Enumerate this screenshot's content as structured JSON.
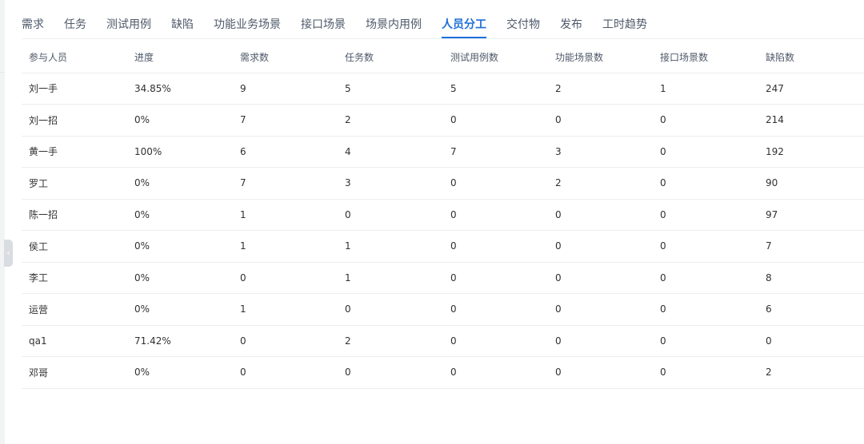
{
  "tabs": [
    {
      "label": "需求",
      "active": false
    },
    {
      "label": "任务",
      "active": false
    },
    {
      "label": "测试用例",
      "active": false
    },
    {
      "label": "缺陷",
      "active": false
    },
    {
      "label": "功能业务场景",
      "active": false
    },
    {
      "label": "接口场景",
      "active": false
    },
    {
      "label": "场景内用例",
      "active": false
    },
    {
      "label": "人员分工",
      "active": true
    },
    {
      "label": "交付物",
      "active": false
    },
    {
      "label": "发布",
      "active": false
    },
    {
      "label": "工时趋势",
      "active": false
    }
  ],
  "sidebar": {
    "collapse_glyph": "‹"
  },
  "table": {
    "columns": [
      "参与人员",
      "进度",
      "需求数",
      "任务数",
      "测试用例数",
      "功能场景数",
      "接口场景数",
      "缺陷数"
    ],
    "rows": [
      [
        "刘一手",
        "34.85%",
        "9",
        "5",
        "5",
        "2",
        "1",
        "247"
      ],
      [
        "刘一招",
        "0%",
        "7",
        "2",
        "0",
        "0",
        "0",
        "214"
      ],
      [
        "黄一手",
        "100%",
        "6",
        "4",
        "7",
        "3",
        "0",
        "192"
      ],
      [
        "罗工",
        "0%",
        "7",
        "3",
        "0",
        "2",
        "0",
        "90"
      ],
      [
        "陈一招",
        "0%",
        "1",
        "0",
        "0",
        "0",
        "0",
        "97"
      ],
      [
        "侯工",
        "0%",
        "1",
        "1",
        "0",
        "0",
        "0",
        "7"
      ],
      [
        "李工",
        "0%",
        "0",
        "1",
        "0",
        "0",
        "0",
        "8"
      ],
      [
        "运营",
        "0%",
        "1",
        "0",
        "0",
        "0",
        "0",
        "6"
      ],
      [
        "qa1",
        "71.42%",
        "0",
        "2",
        "0",
        "0",
        "0",
        "0"
      ],
      [
        "邓哥",
        "0%",
        "0",
        "0",
        "0",
        "0",
        "0",
        "2"
      ]
    ]
  }
}
